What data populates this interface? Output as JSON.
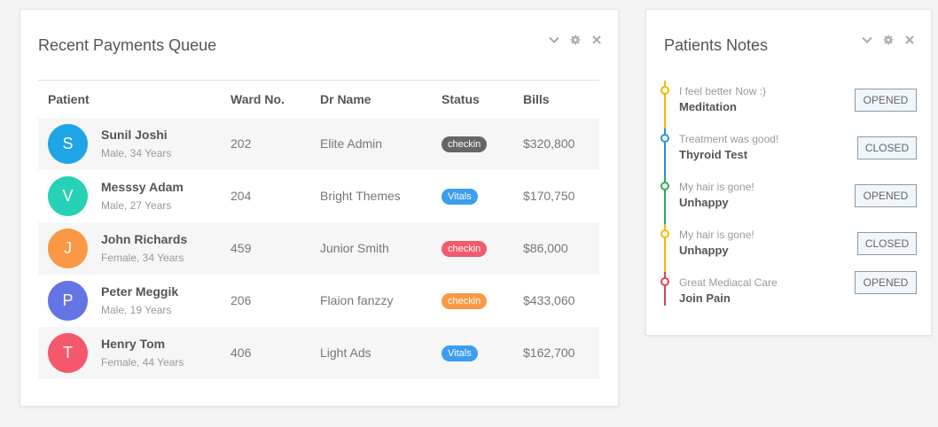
{
  "payments": {
    "title": "Recent Payments Queue",
    "headers": [
      "Patient",
      "Ward No.",
      "Dr Name",
      "Status",
      "Bills"
    ],
    "rows": [
      {
        "initial": "S",
        "avatar_color": "#1fa4e6",
        "name": "Sunil Joshi",
        "info": "Male, 34 Years",
        "ward": "202",
        "doctor": "Elite Admin",
        "status": "checkin",
        "status_color": "#666666",
        "bill": "$320,800"
      },
      {
        "initial": "V",
        "avatar_color": "#27d1b5",
        "name": "Messsy Adam",
        "info": "Male, 27 Years",
        "ward": "204",
        "doctor": "Bright Themes",
        "status": "Vitals",
        "status_color": "#3b9ef0",
        "bill": "$170,750"
      },
      {
        "initial": "J",
        "avatar_color": "#fb9845",
        "name": "John Richards",
        "info": "Female, 34 Years",
        "ward": "459",
        "doctor": "Junior Smith",
        "status": "checkin",
        "status_color": "#f25a6e",
        "bill": "$86,000"
      },
      {
        "initial": "P",
        "avatar_color": "#6474e5",
        "name": "Peter Meggik",
        "info": "Male, 19 Years",
        "ward": "206",
        "doctor": "Flaion fanzzy",
        "status": "checkin",
        "status_color": "#fb9845",
        "bill": "$433,060"
      },
      {
        "initial": "T",
        "avatar_color": "#f5586c",
        "name": "Henry Tom",
        "info": "Female, 44 Years",
        "ward": "406",
        "doctor": "Light Ads",
        "status": "Vitals",
        "status_color": "#3b9ef0",
        "bill": "$162,700"
      }
    ]
  },
  "notes": {
    "title": "Patients Notes",
    "items": [
      {
        "subtitle": "I feel better Now :)",
        "label": "Meditation",
        "button": "OPENED",
        "color": "#f5b800"
      },
      {
        "subtitle": "Treatment was good!",
        "label": "Thyroid Test",
        "button": "CLOSED",
        "color": "#2d8fd6"
      },
      {
        "subtitle": "My hair is gone!",
        "label": "Unhappy",
        "button": "OPENED",
        "color": "#2eaa5a"
      },
      {
        "subtitle": "My hair is gone!",
        "label": "Unhappy",
        "button": "CLOSED",
        "color": "#f5b800"
      },
      {
        "subtitle": "Great Mediacal Care",
        "label": "Join Pain",
        "button": "OPENED",
        "color": "#d9464f"
      }
    ]
  },
  "icons": [
    "chevron-down-icon",
    "gear-icon",
    "close-icon"
  ]
}
